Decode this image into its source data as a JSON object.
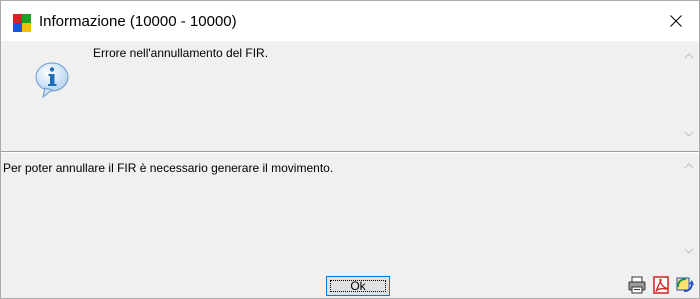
{
  "window": {
    "title": "Informazione (10000 - 10000)"
  },
  "message": {
    "main": "Errore nell'annullamento del FIR.",
    "detail": "Per poter annullare il FIR è necessario generare il movimento."
  },
  "buttons": {
    "ok_label": "Ok"
  },
  "icons": {
    "app": "app-logo-icon",
    "close": "close-icon",
    "info": "info-icon",
    "print": "print-icon",
    "pdf": "pdf-icon",
    "export": "export-icon"
  },
  "colors": {
    "accent": "#0078d7",
    "info_blue": "#1e6fb8",
    "pdf_red": "#d42020"
  }
}
